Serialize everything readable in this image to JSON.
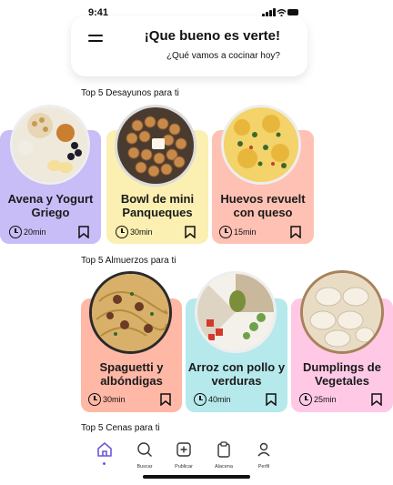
{
  "status_bar": {
    "time": "9:41"
  },
  "header": {
    "title": "¡Que bueno es verte!",
    "subtitle": "¿Qué vamos a cocinar hoy?"
  },
  "sections": {
    "breakfast": {
      "title": "Top 5 Desayunos para ti",
      "cards": [
        {
          "title_line1": "Avena y Yogurt",
          "title_line2": "Griego",
          "time": "20min",
          "color": "#c9bdf7"
        },
        {
          "title_line1": "Bowl de mini",
          "title_line2": "Panqueques",
          "time": "30min",
          "color": "#fbefb1"
        },
        {
          "title_line1": "Huevos revuelt",
          "title_line2": "con queso",
          "time": "15min",
          "color": "#ffc1b3"
        }
      ]
    },
    "lunch": {
      "title": "Top 5 Almuerzos para ti",
      "cards": [
        {
          "title_line1": "Spaguetti y",
          "title_line2": "albóndigas",
          "time": "30min",
          "color": "#ffb7a6"
        },
        {
          "title_line1": "Arroz con pollo y",
          "title_line2": "verduras",
          "time": "40min",
          "color": "#b6e9ec"
        },
        {
          "title_line1": "Dumplings de",
          "title_line2": "Vegetales",
          "time": "25min",
          "color": "#ffc9e6"
        }
      ]
    },
    "dinner": {
      "title": "Top 5 Cenas para ti"
    }
  },
  "tabbar": {
    "items": [
      {
        "label": "",
        "icon": "home-icon"
      },
      {
        "label": "Buscar",
        "icon": "search-icon"
      },
      {
        "label": "Publicar",
        "icon": "plus-square-icon"
      },
      {
        "label": "Alacena",
        "icon": "clipboard-icon"
      },
      {
        "label": "Perfil",
        "icon": "user-icon"
      }
    ],
    "active_color": "#6a5ad8"
  }
}
